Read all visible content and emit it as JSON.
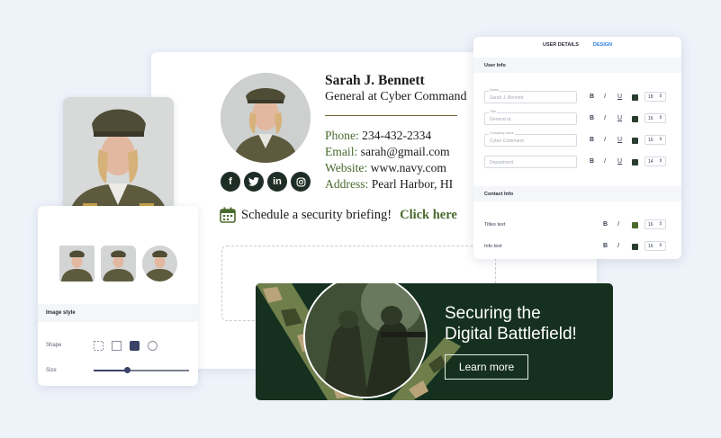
{
  "signature": {
    "name": "Sarah J. Bennett",
    "title": "General at Cyber Command",
    "contact": [
      {
        "label": "Phone:",
        "value": "234-432-2334"
      },
      {
        "label": "Email:",
        "value": "sarah@gmail.com"
      },
      {
        "label": "Website:",
        "value": "www.navy.com"
      },
      {
        "label": "Address:",
        "value": "Pearl Harbor, HI"
      }
    ],
    "social": [
      {
        "icon": "facebook-icon",
        "glyph": "f"
      },
      {
        "icon": "twitter-icon",
        "glyph": "t"
      },
      {
        "icon": "linkedin-icon",
        "glyph": "in"
      },
      {
        "icon": "instagram-icon",
        "glyph": "◎"
      }
    ],
    "cta_text": "Schedule a security briefing!",
    "cta_link": "Click here",
    "accent_color": "#4a6a2e"
  },
  "image_style": {
    "heading": "Image style",
    "shape_label": "Shape",
    "size_label": "Size",
    "size_level": 0.35
  },
  "settings": {
    "tabs": [
      {
        "label": "USER DETAILS"
      },
      {
        "label": "DESIGN"
      }
    ],
    "user_info_heading": "User Info",
    "fields": [
      {
        "label": "Name",
        "value": "Sarah J. Bennett",
        "swatch": "#2a3d2f",
        "size": "18"
      },
      {
        "label": "Title",
        "value": "General at",
        "swatch": "#2a3d2f",
        "size": "16"
      },
      {
        "label": "Company name",
        "value": "Cyber Command",
        "swatch": "#2a3d2f",
        "size": "16"
      },
      {
        "label": "",
        "value": "Department",
        "swatch": "#2a3d2f",
        "size": "14"
      }
    ],
    "contact_info_heading": "Contact Info",
    "contact_rows": [
      {
        "label": "Titles text",
        "swatch": "#4a6a2e",
        "size": "16"
      },
      {
        "label": "Info text",
        "swatch": "#2a3d2f",
        "size": "16"
      }
    ],
    "format_glyphs": {
      "bold": "B",
      "italic": "I",
      "underline": "U",
      "arrows": "⇕"
    }
  },
  "banner": {
    "title_line1": "Securing the",
    "title_line2": "Digital Battlefield!",
    "button_label": "Learn more"
  }
}
